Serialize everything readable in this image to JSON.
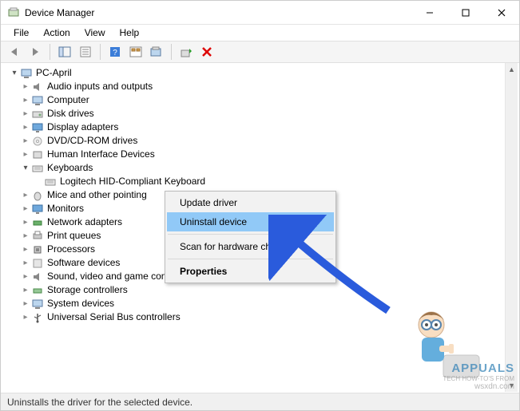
{
  "window": {
    "title": "Device Manager"
  },
  "menubar": {
    "file": "File",
    "action": "Action",
    "view": "View",
    "help": "Help"
  },
  "tree": {
    "root": "PC-April",
    "items": [
      {
        "label": "Audio inputs and outputs"
      },
      {
        "label": "Computer"
      },
      {
        "label": "Disk drives"
      },
      {
        "label": "Display adapters"
      },
      {
        "label": "DVD/CD-ROM drives"
      },
      {
        "label": "Human Interface Devices"
      },
      {
        "label": "Keyboards",
        "expanded": true,
        "child": "Logitech HID-Compliant Keyboard"
      },
      {
        "label": "Mice and other pointing"
      },
      {
        "label": "Monitors"
      },
      {
        "label": "Network adapters"
      },
      {
        "label": "Print queues"
      },
      {
        "label": "Processors"
      },
      {
        "label": "Software devices"
      },
      {
        "label": "Sound, video and game controllers"
      },
      {
        "label": "Storage controllers"
      },
      {
        "label": "System devices"
      },
      {
        "label": "Universal Serial Bus controllers"
      }
    ]
  },
  "context_menu": {
    "update": "Update driver",
    "uninstall": "Uninstall device",
    "scan": "Scan for hardware changes",
    "properties": "Properties"
  },
  "statusbar": {
    "text": "Uninstalls the driver for the selected device."
  },
  "watermark": {
    "brand": "APPUALS",
    "tag1": "TECH HOW-TO'S FROM",
    "tag2": "wsxdn.com"
  }
}
